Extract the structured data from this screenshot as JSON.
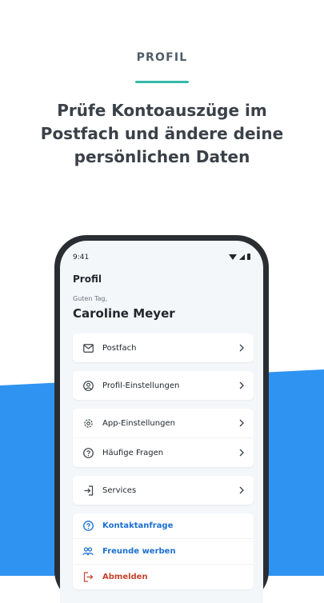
{
  "intro": {
    "section_label": "PROFIL",
    "headline": "Prüfe Kontoauszüge im Postfach und ändere deine persönlichen Daten"
  },
  "phone": {
    "status_time": "9:41",
    "screen_title": "Profil",
    "greeting": "Guten Tag,",
    "user_name": "Caroline Meyer",
    "menu": {
      "postfach": "Postfach",
      "profil_einstellungen": "Profil-Einstellungen",
      "app_einstellungen": "App-Einstellungen",
      "haeufige_fragen": "Häufige Fragen",
      "services": "Services",
      "kontaktanfrage": "Kontaktanfrage",
      "freunde_werben": "Freunde werben",
      "abmelden": "Abmelden"
    }
  },
  "colors": {
    "accent_teal": "#36b9a8",
    "band_blue": "#2f93f1",
    "link_blue": "#1b6fd0",
    "logout_red": "#c8442e"
  },
  "icons": [
    "mail-icon",
    "user-circle-icon",
    "gear-icon",
    "help-icon",
    "exit-icon",
    "question-icon",
    "friends-icon",
    "logout-icon",
    "chevron-right-icon"
  ]
}
